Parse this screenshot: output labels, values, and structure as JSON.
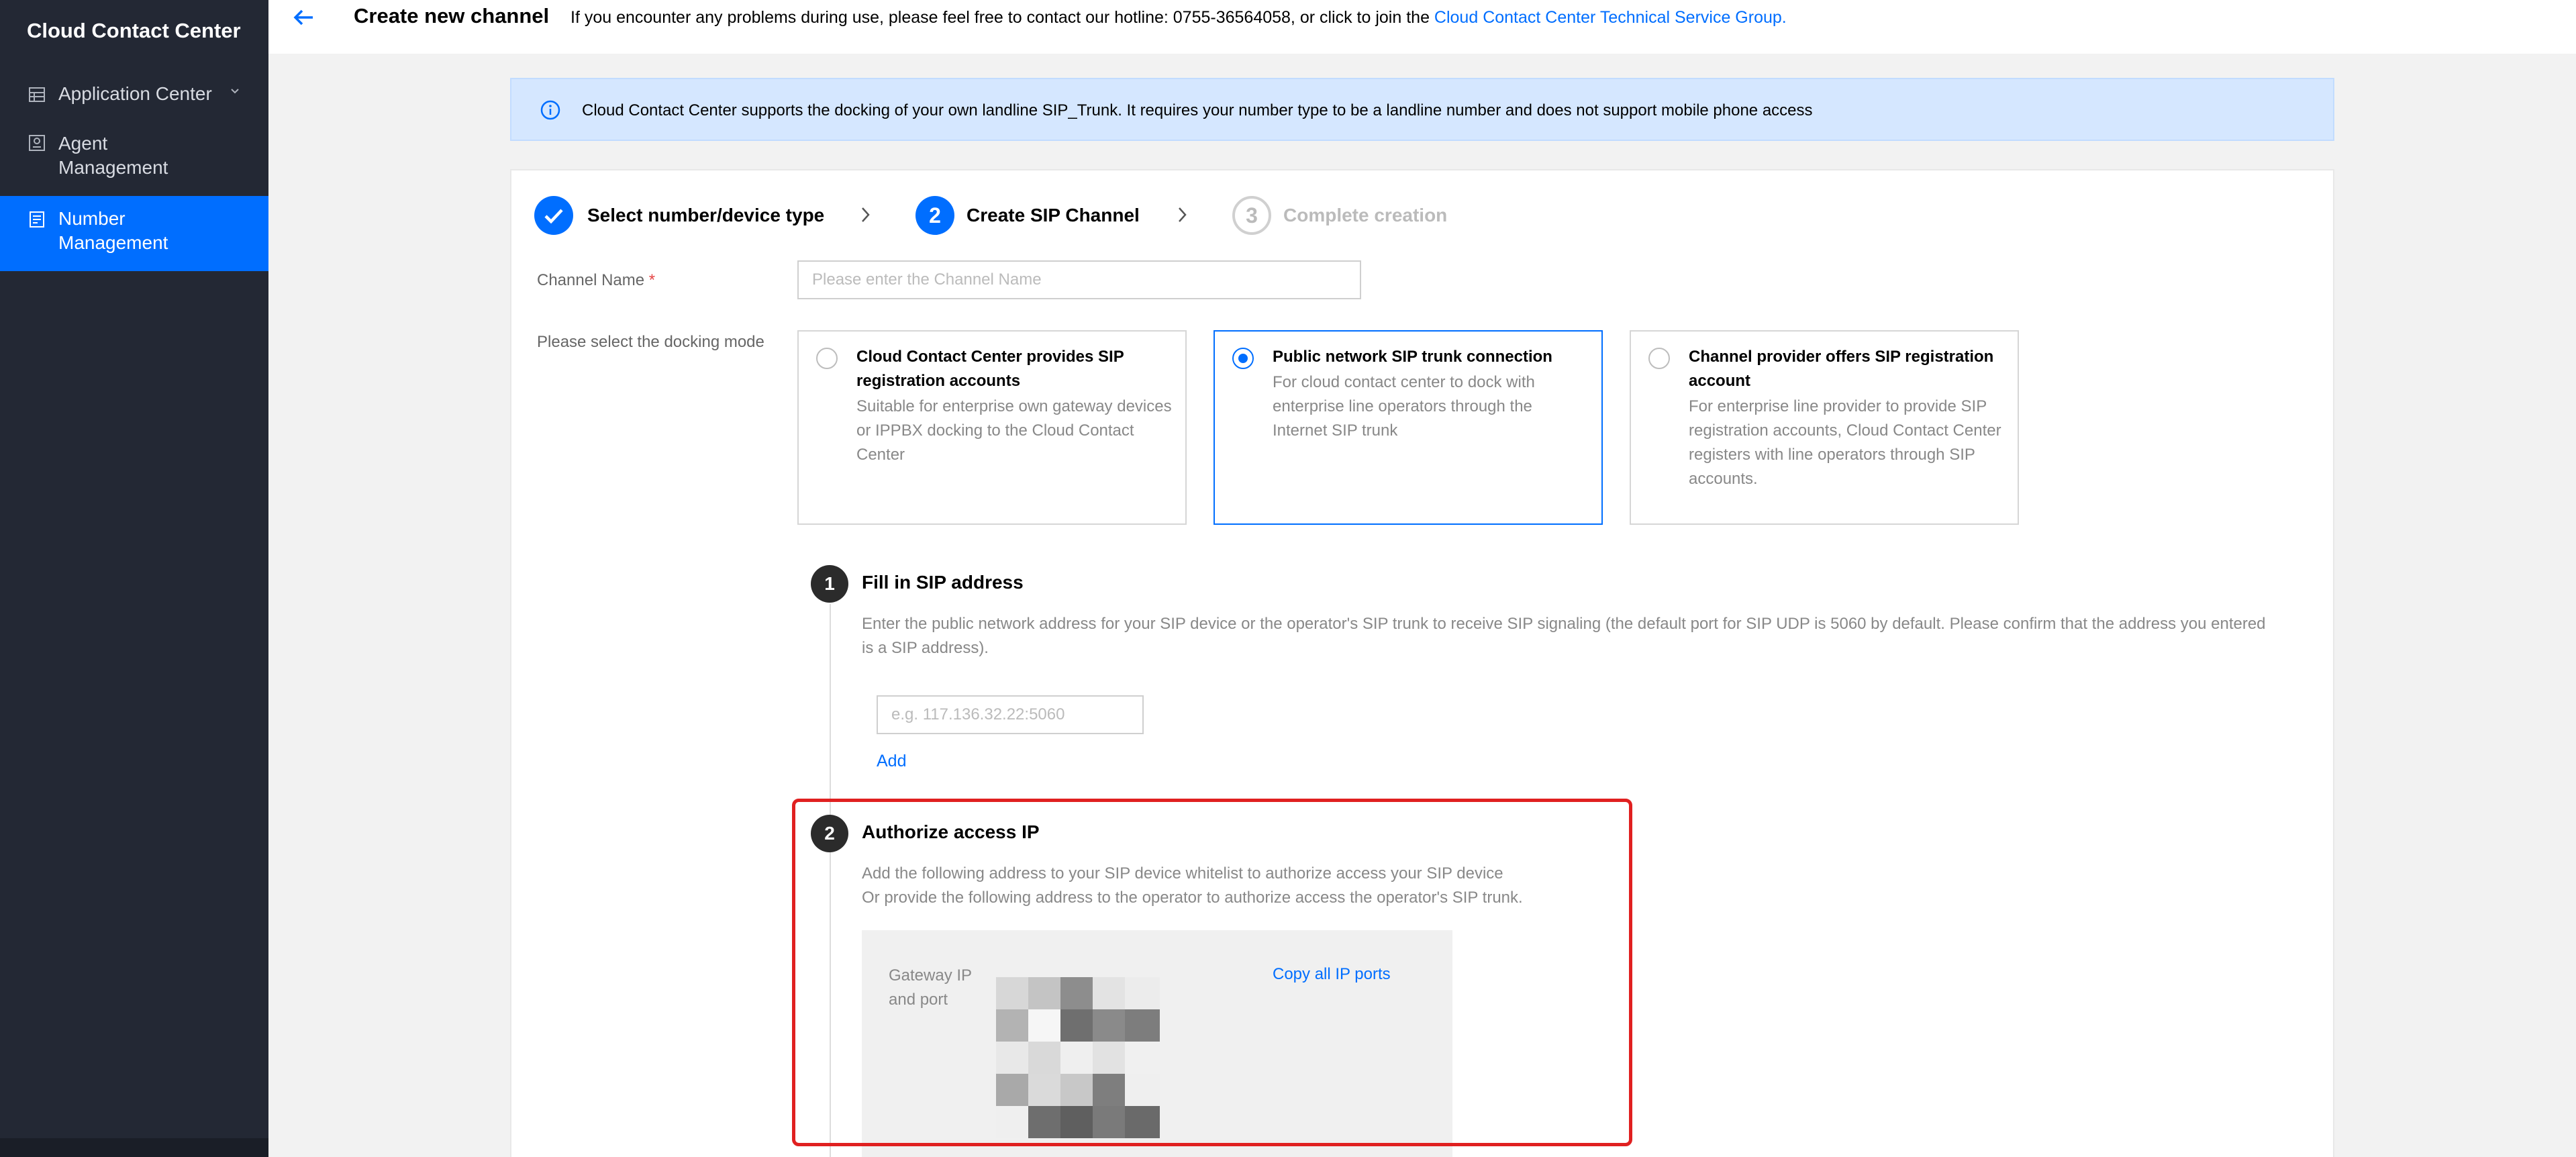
{
  "sidebar": {
    "brand": "Cloud Contact Center",
    "items": [
      {
        "label": "Application Center",
        "icon": "app-grid-icon",
        "expandable": true
      },
      {
        "label_line1": "Agent",
        "label_line2": "Management",
        "icon": "agent-icon"
      },
      {
        "label_line1": "Number",
        "label_line2": "Management",
        "icon": "number-icon",
        "active": true
      }
    ]
  },
  "header": {
    "title": "Create new channel",
    "hotline_text": "If you encounter any problems during use, please feel free to contact our hotline: 0755-36564058, or click to join the",
    "group_link": "Cloud Contact Center Technical Service Group."
  },
  "notice": {
    "text": "Cloud Contact Center supports the docking of your own landline SIP_Trunk. It requires your number type to be a landline number and does not support mobile phone access"
  },
  "steps": [
    {
      "label": "Select number/device type",
      "state": "done"
    },
    {
      "number": "2",
      "label": "Create SIP Channel",
      "state": "active"
    },
    {
      "number": "3",
      "label": "Complete creation",
      "state": "pending"
    }
  ],
  "form": {
    "channel_name_label": "Channel Name",
    "required_mark": "*",
    "channel_name_placeholder": "Please enter the Channel Name",
    "docking_mode_label": "Please select the docking mode"
  },
  "modes": [
    {
      "title": "Cloud Contact Center provides SIP registration accounts",
      "desc": "Suitable for enterprise own gateway devices or IPPBX docking to the Cloud Contact Center",
      "selected": false
    },
    {
      "title": "Public network SIP trunk connection",
      "desc": "For cloud contact center to dock with enterprise line operators through the Internet SIP trunk",
      "selected": true
    },
    {
      "title": "Channel provider offers SIP registration account",
      "desc": "For enterprise line provider to provide SIP registration accounts, Cloud Contact Center registers with line operators through SIP accounts.",
      "selected": false
    }
  ],
  "sip_section": {
    "number": "1",
    "title": "Fill in SIP address",
    "desc": "Enter the public network address for your SIP device or the operator's SIP trunk to receive SIP signaling (the default port for SIP UDP is 5060 by default. Please confirm that the address you entered is a SIP address).",
    "address_placeholder": "e.g. 117.136.32.22:5060",
    "add_label": "Add"
  },
  "auth_section": {
    "number": "2",
    "title": "Authorize access IP",
    "desc_line1": "Add the following address to your SIP device whitelist to authorize access your SIP device",
    "desc_line2": "Or provide the following address to the operator to authorize access the operator's SIP trunk.",
    "gateway_label": "Gateway IP and port",
    "copy_label": "Copy all IP ports"
  },
  "colors": {
    "sidebar_bg": "#232834",
    "accent": "#006eff",
    "notice_bg": "#d5e7ff",
    "highlight": "#e02020"
  }
}
